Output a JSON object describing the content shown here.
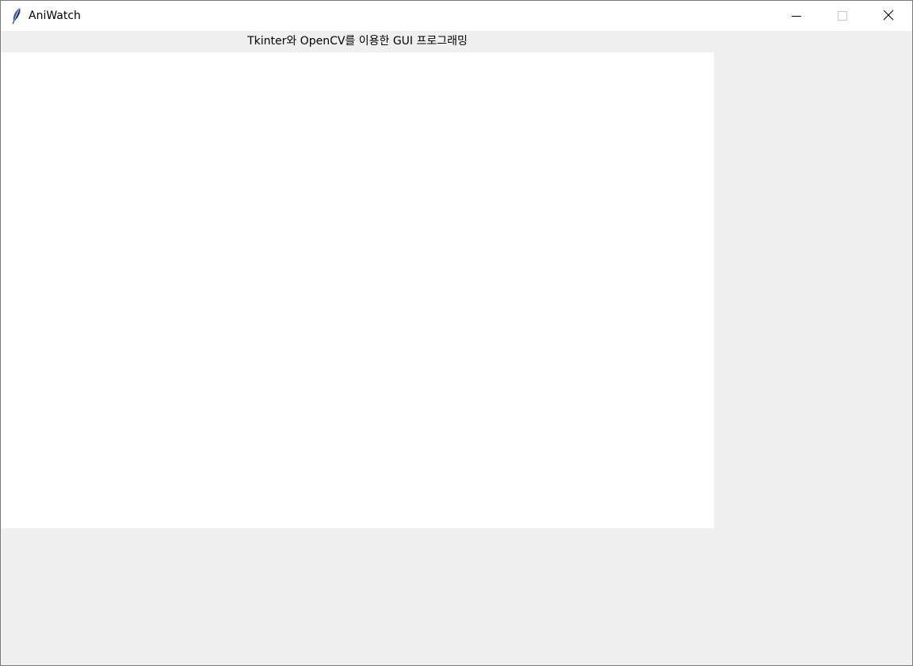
{
  "window": {
    "title": "AniWatch",
    "app_icon": "feather-icon",
    "controls": {
      "minimize_icon": "minimize-icon",
      "maximize_icon": "maximize-icon",
      "close_icon": "close-icon"
    }
  },
  "main": {
    "header_label": "Tkinter와 OpenCV를 이용한 GUI 프로그래밍",
    "canvas_background": "#ffffff"
  },
  "colors": {
    "window_background": "#f0f0f0",
    "titlebar_background": "#ffffff",
    "text": "#000000"
  }
}
